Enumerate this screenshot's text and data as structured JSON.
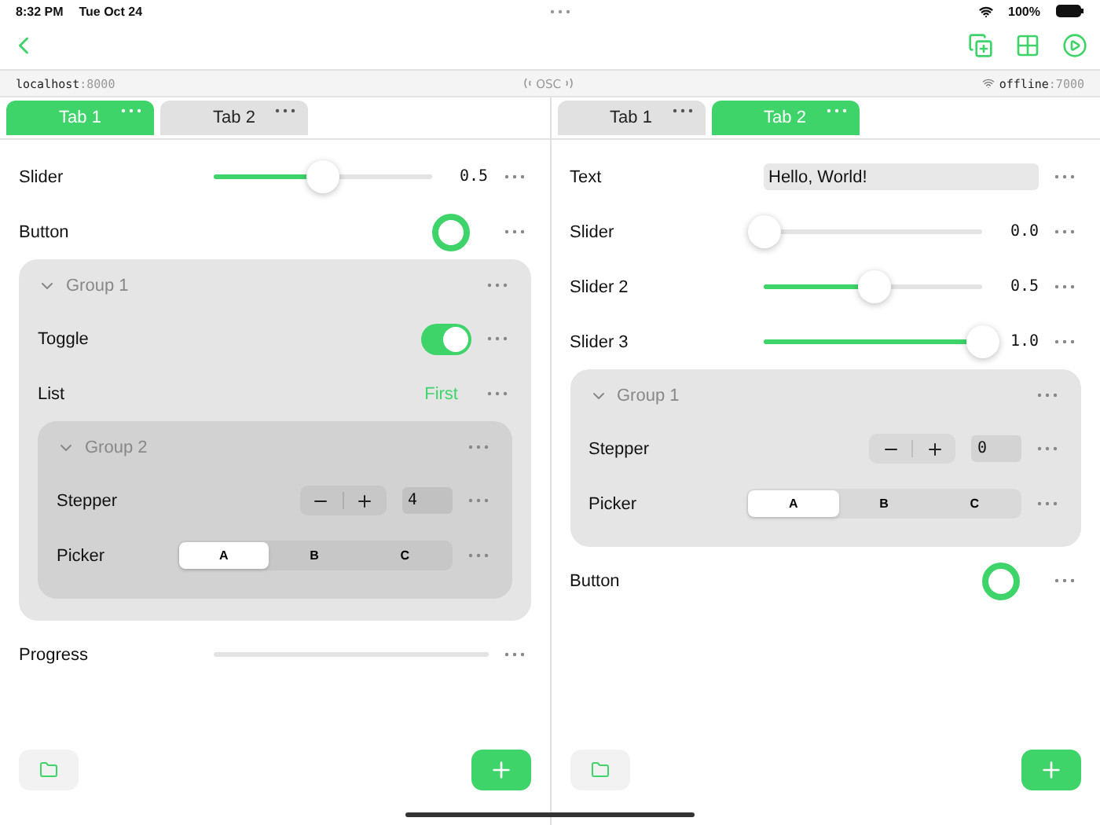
{
  "status_bar": {
    "time": "8:32 PM",
    "date": "Tue Oct 24",
    "battery": "100%"
  },
  "address_bar": {
    "host": "localhost",
    "host_port": ":8000",
    "center": "OSC",
    "peer": "offline",
    "peer_port": ":7000"
  },
  "panes": [
    {
      "tabs": [
        {
          "label": "Tab 1",
          "selected": true
        },
        {
          "label": "Tab 2",
          "selected": false
        }
      ],
      "controls": [
        {
          "kind": "slider",
          "label": "Slider",
          "level": 0.5,
          "reading": "0.5"
        },
        {
          "kind": "button",
          "label": "Button"
        },
        {
          "kind": "group",
          "label": "Group 1",
          "expanded": true,
          "children": [
            {
              "kind": "toggle",
              "label": "Toggle",
              "on": true
            },
            {
              "kind": "list",
              "label": "List",
              "value": "First"
            },
            {
              "kind": "group",
              "label": "Group 2",
              "expanded": true,
              "children": [
                {
                  "kind": "stepper",
                  "label": "Stepper",
                  "value": "4"
                },
                {
                  "kind": "picker",
                  "label": "Picker",
                  "options": [
                    {
                      "label": "A",
                      "selected": true
                    },
                    {
                      "label": "B",
                      "selected": false
                    },
                    {
                      "label": "C",
                      "selected": false
                    }
                  ]
                }
              ]
            }
          ]
        },
        {
          "kind": "progress",
          "label": "Progress",
          "level": 0
        }
      ]
    },
    {
      "tabs": [
        {
          "label": "Tab 1",
          "selected": false
        },
        {
          "label": "Tab 2",
          "selected": true
        }
      ],
      "controls": [
        {
          "kind": "text",
          "label": "Text",
          "value": "Hello, World!"
        },
        {
          "kind": "slider",
          "label": "Slider",
          "level": 0,
          "reading": "0.0"
        },
        {
          "kind": "slider",
          "label": "Slider 2",
          "level": 0.5,
          "reading": "0.5"
        },
        {
          "kind": "slider",
          "label": "Slider 3",
          "level": 1,
          "reading": "1.0"
        },
        {
          "kind": "group",
          "label": "Group 1",
          "expanded": true,
          "children": [
            {
              "kind": "stepper",
              "label": "Stepper",
              "value": "0"
            },
            {
              "kind": "picker",
              "label": "Picker",
              "options": [
                {
                  "label": "A",
                  "selected": true
                },
                {
                  "label": "B",
                  "selected": false
                },
                {
                  "label": "C",
                  "selected": false
                }
              ]
            }
          ]
        },
        {
          "kind": "button",
          "label": "Button"
        }
      ]
    }
  ]
}
